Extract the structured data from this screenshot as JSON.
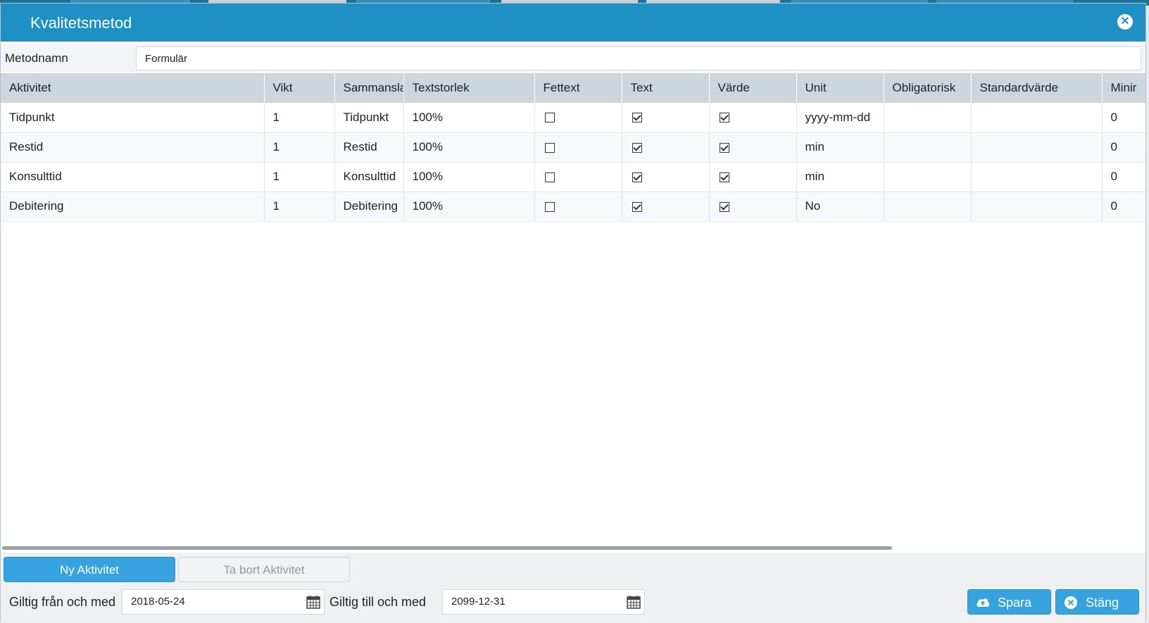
{
  "dialog": {
    "title": "Kvalitetsmetod",
    "close_icon": "close-circle-icon"
  },
  "method": {
    "label": "Metodnamn",
    "value": "Formulär"
  },
  "table": {
    "columns": [
      "Aktivitet",
      "Vikt",
      "Sammansla",
      "Textstorlek",
      "Fettext",
      "Text",
      "Värde",
      "Unit",
      "Obligatorisk",
      "Standardvärde",
      "Minir"
    ],
    "rows": [
      {
        "aktivitet": "Tidpunkt",
        "vikt": "1",
        "sammansla": "Tidpunkt",
        "textstorlek": "100%",
        "fettext": false,
        "text": true,
        "varde": true,
        "unit": "yyyy-mm-dd",
        "obligatorisk": "",
        "standardvarde": "",
        "min": "0"
      },
      {
        "aktivitet": "Restid",
        "vikt": "1",
        "sammansla": "Restid",
        "textstorlek": "100%",
        "fettext": false,
        "text": true,
        "varde": true,
        "unit": "min",
        "obligatorisk": "",
        "standardvarde": "",
        "min": "0"
      },
      {
        "aktivitet": "Konsulttid",
        "vikt": "1",
        "sammansla": "Konsulttid",
        "textstorlek": "100%",
        "fettext": false,
        "text": true,
        "varde": true,
        "unit": "min",
        "obligatorisk": "",
        "standardvarde": "",
        "min": "0"
      },
      {
        "aktivitet": "Debitering",
        "vikt": "1",
        "sammansla": "Debitering",
        "textstorlek": "100%",
        "fettext": false,
        "text": true,
        "varde": true,
        "unit": "No",
        "obligatorisk": "",
        "standardvarde": "",
        "min": "0"
      }
    ]
  },
  "footer": {
    "new_activity": "Ny Aktivitet",
    "delete_activity": "Ta bort Aktivitet",
    "valid_from_label": "Giltig från och med",
    "valid_from_value": "2018-05-24",
    "valid_to_label": "Giltig till och med",
    "valid_to_value": "2099-12-31",
    "save": "Spara",
    "close": "Stäng"
  },
  "colors": {
    "titlebar": "#1f90c4",
    "primary_button": "#36a3df",
    "header_row": "#cdd6df"
  }
}
